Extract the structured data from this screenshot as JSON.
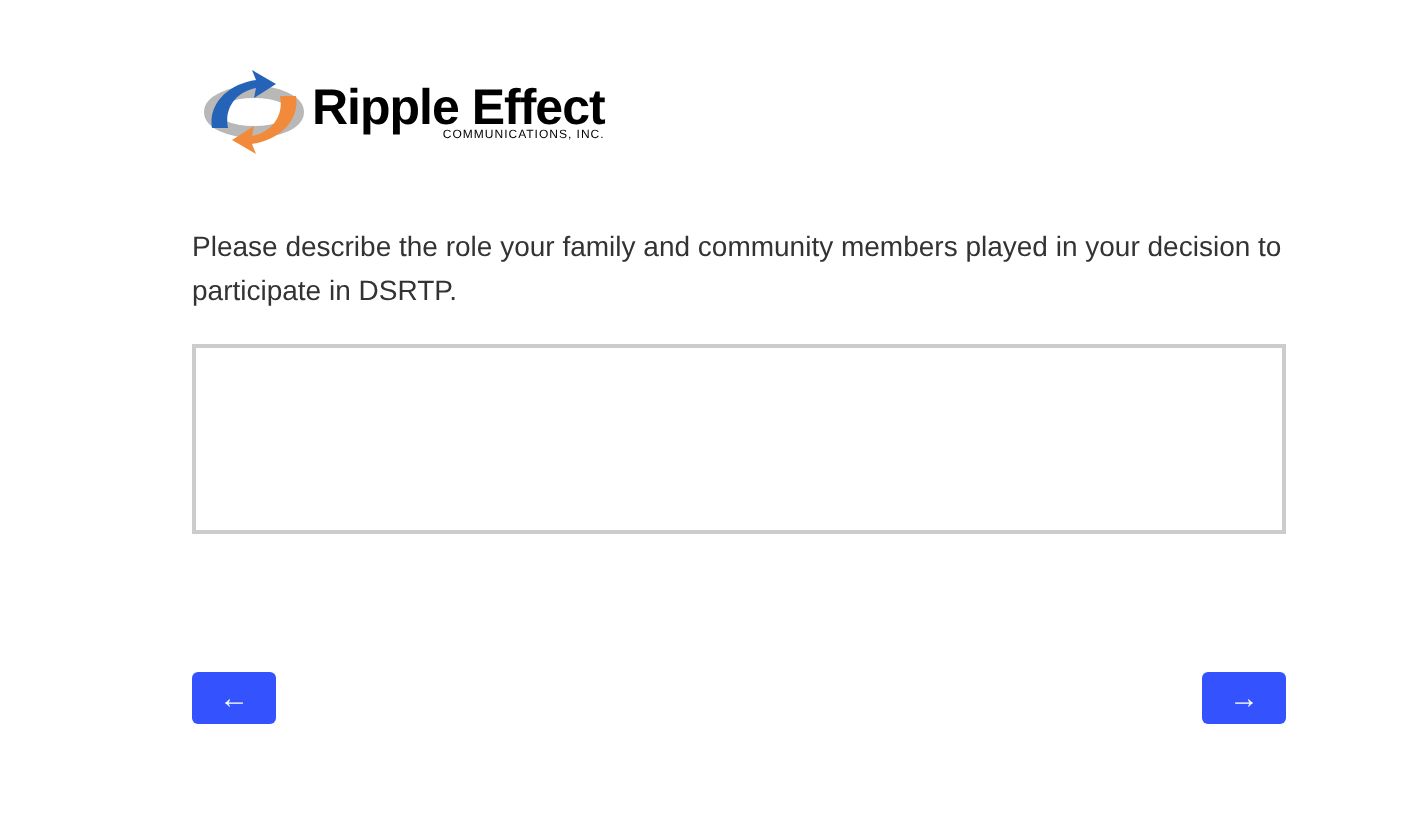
{
  "logo": {
    "name": "Ripple Effect",
    "subtitle": "COMMUNICATIONS, INC."
  },
  "question": {
    "text": "Please describe the role your family and community members played in your decision to participate in DSRTP."
  },
  "navigation": {
    "back": "←",
    "next": "→"
  }
}
